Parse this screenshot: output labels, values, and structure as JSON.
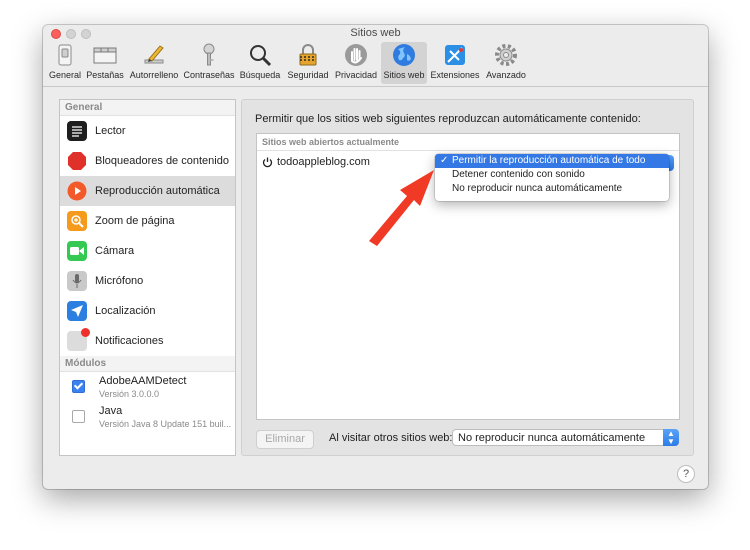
{
  "window": {
    "title": "Sitios web"
  },
  "toolbar": {
    "items": [
      {
        "label": "General",
        "icon": "switch-icon"
      },
      {
        "label": "Pestañas",
        "icon": "tabs-icon"
      },
      {
        "label": "Autorrelleno",
        "icon": "pencil-icon"
      },
      {
        "label": "Contraseñas",
        "icon": "key-icon"
      },
      {
        "label": "Búsqueda",
        "icon": "magnifier-icon"
      },
      {
        "label": "Seguridad",
        "icon": "padlock-icon"
      },
      {
        "label": "Privacidad",
        "icon": "hand-icon"
      },
      {
        "label": "Sitios web",
        "icon": "globe-icon",
        "active": true
      },
      {
        "label": "Extensiones",
        "icon": "puzzle-icon"
      },
      {
        "label": "Avanzado",
        "icon": "gear-icon"
      }
    ]
  },
  "sidebar": {
    "general_header": "General",
    "items": [
      {
        "label": "Lector",
        "icon": "reader-icon"
      },
      {
        "label": "Bloqueadores de contenido",
        "icon": "stop-sign-icon"
      },
      {
        "label": "Reproducción automática",
        "icon": "play-icon",
        "selected": true
      },
      {
        "label": "Zoom de página",
        "icon": "zoom-icon"
      },
      {
        "label": "Cámara",
        "icon": "camera-icon"
      },
      {
        "label": "Micrófono",
        "icon": "microphone-icon"
      },
      {
        "label": "Localización",
        "icon": "location-arrow-icon"
      },
      {
        "label": "Notificaciones",
        "icon": "notification-icon"
      }
    ],
    "modules_header": "Módulos",
    "modules": [
      {
        "name": "AdobeAAMDetect",
        "version": "Versión 3.0.0.0",
        "checked": true
      },
      {
        "name": "Java",
        "version": "Versión Java 8 Update 151 buil...",
        "checked": false
      }
    ]
  },
  "panel": {
    "description": "Permitir que los sitios web siguientes reproduzcan automáticamente contenido:",
    "list_header": "Sitios web abiertos actualmente",
    "site": "todoappleblog.com",
    "menu": {
      "options": [
        "Permitir la reproducción automática de todo",
        "Detener contenido con sonido",
        "No reproducir nunca automáticamente"
      ],
      "checkmark": "✓"
    },
    "remove_label": "Eliminar",
    "visit_label": "Al visitar otros sitios web:",
    "visit_value": "No reproducir nunca automáticamente"
  },
  "help_label": "?",
  "colors": {
    "accent": "#3478e5",
    "annotation_arrow": "#f03a26"
  }
}
